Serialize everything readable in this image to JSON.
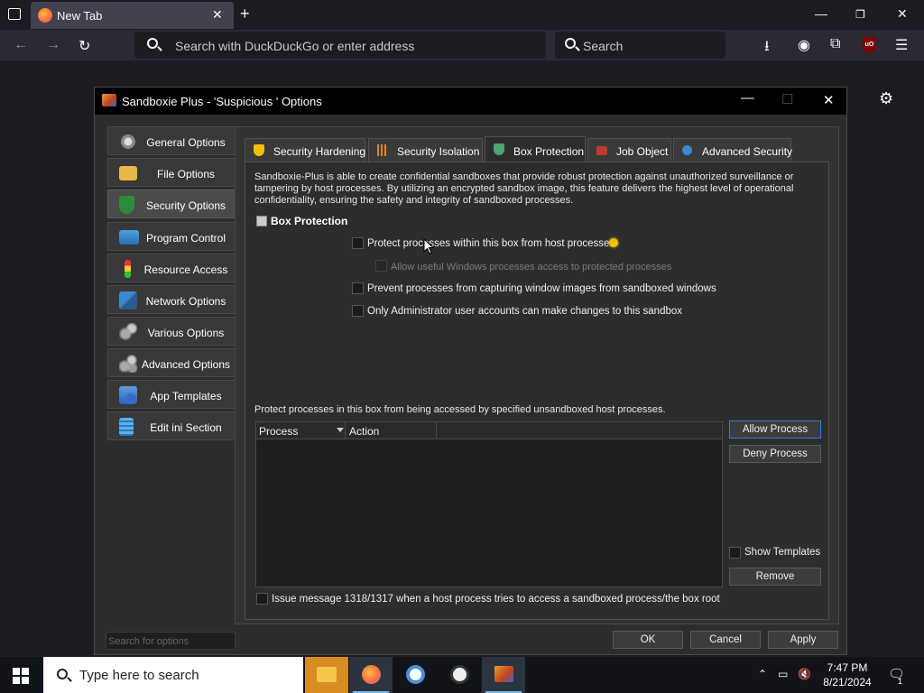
{
  "browser": {
    "tab_title": "New Tab",
    "url_placeholder": "Search with DuckDuckGo or enter address",
    "search_placeholder": "Search",
    "ublock_label": "uO"
  },
  "dialog": {
    "title": "Sandboxie Plus - 'Suspicious ' Options",
    "nav": [
      {
        "label": "General Options",
        "icon": "gear-icon"
      },
      {
        "label": "File Options",
        "icon": "folder-icon"
      },
      {
        "label": "Security Options",
        "icon": "shield-icon"
      },
      {
        "label": "Program Control",
        "icon": "window-icon"
      },
      {
        "label": "Resource Access",
        "icon": "traffic-light-icon"
      },
      {
        "label": "Network Options",
        "icon": "network-icon"
      },
      {
        "label": "Various Options",
        "icon": "gears-icon"
      },
      {
        "label": "Advanced Options",
        "icon": "advanced-gears-icon"
      },
      {
        "label": "App Templates",
        "icon": "templates-icon"
      },
      {
        "label": "Edit ini Section",
        "icon": "ini-file-icon"
      }
    ],
    "active_nav": "Security Options",
    "search_placeholder": "Search for options",
    "tabs": [
      {
        "label": "Security Hardening",
        "icon": "shield-warning-icon"
      },
      {
        "label": "Security Isolation",
        "icon": "bars-icon"
      },
      {
        "label": "Box Protection",
        "icon": "shield-check-icon"
      },
      {
        "label": "Job Object",
        "icon": "job-object-icon"
      },
      {
        "label": "Advanced Security",
        "icon": "advanced-security-icon"
      }
    ],
    "active_tab": "Box Protection",
    "description": "Sandboxie-Plus is able to create confidential sandboxes that provide robust protection against unauthorized surveillance or tampering by host processes. By utilizing an encrypted sandbox image, this feature delivers the highest level of operational confidentiality, ensuring the safety and integrity of sandboxed processes.",
    "section_title": "Box Protection",
    "options": {
      "protect": "Protect processes within this box from host processes",
      "allow_windows": "Allow useful Windows processes access to protected processes",
      "prevent_capture": "Prevent processes from capturing window images from sandboxed windows",
      "admin_only": "Only Administrator user accounts can make changes to this sandbox"
    },
    "list_description": "Protect processes in this box from being accessed by specified unsandboxed host processes.",
    "table_columns": [
      "Process",
      "Action"
    ],
    "buttons": {
      "allow_process": "Allow Process",
      "deny_process": "Deny Process",
      "remove": "Remove",
      "ok": "OK",
      "cancel": "Cancel",
      "apply": "Apply"
    },
    "show_templates": "Show Templates",
    "issue_message": "Issue message 1318/1317 when a host process tries to access a sandboxed process/the box root"
  },
  "taskbar": {
    "search_placeholder": "Type here to search",
    "time": "7:47 PM",
    "date": "8/21/2024",
    "notification_count": "1"
  }
}
